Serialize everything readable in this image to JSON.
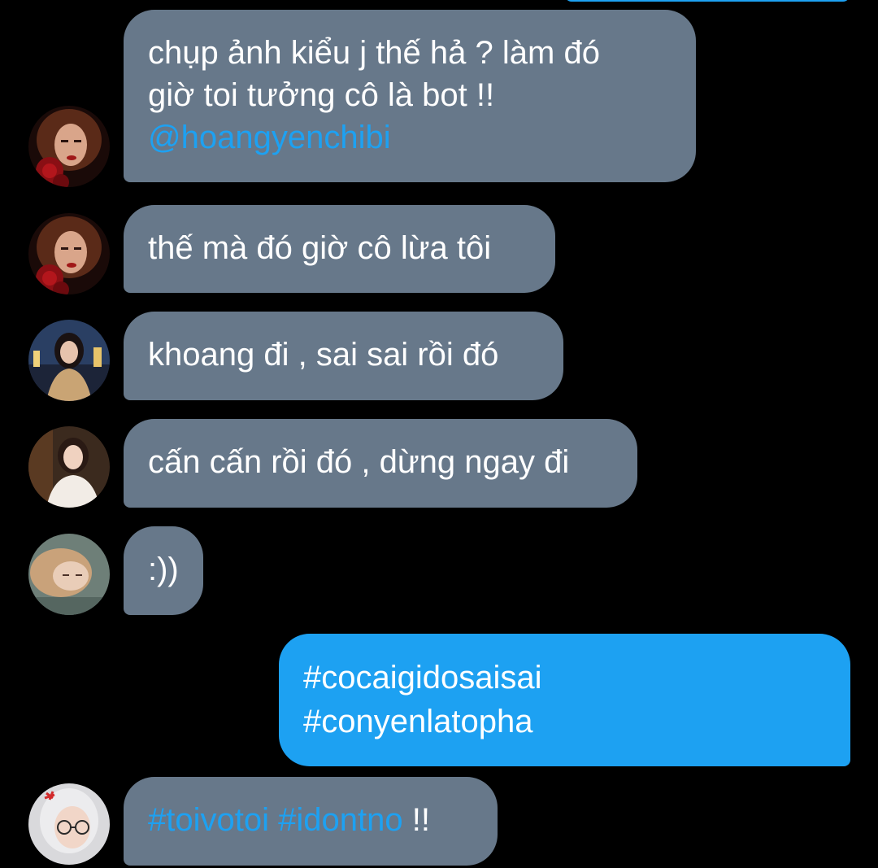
{
  "colors": {
    "background": "#000000",
    "incoming_bubble": "#67788a",
    "outgoing_bubble": "#1da1f2",
    "link": "#1da1f2",
    "text": "#ffffff"
  },
  "messages": [
    {
      "direction": "incoming",
      "avatar": "avatar-woman-red-rose",
      "lines": [
        "chụp ảnh kiểu j thế hả ? làm đó",
        "giờ toi tưởng cô là bot !!"
      ],
      "mention": "@hoangyenchibi"
    },
    {
      "direction": "incoming",
      "avatar": "avatar-woman-red-rose",
      "text": "thế mà đó giờ cô lừa tôi"
    },
    {
      "direction": "incoming",
      "avatar": "avatar-woman-city-night",
      "text": "khoang đi , sai sai rồi đó"
    },
    {
      "direction": "incoming",
      "avatar": "avatar-woman-cafe",
      "text": "cấn cấn rồi đó , dừng ngay đi"
    },
    {
      "direction": "incoming",
      "avatar": "avatar-woman-lying",
      "text": ":))"
    },
    {
      "direction": "outgoing",
      "lines": [
        "#cocaigidosaisai",
        "#conyenlatopha"
      ]
    },
    {
      "direction": "incoming",
      "avatar": "avatar-girl-glasses",
      "hashtags": [
        "#toivotoi",
        "#idontno"
      ],
      "suffix": "!!"
    }
  ]
}
